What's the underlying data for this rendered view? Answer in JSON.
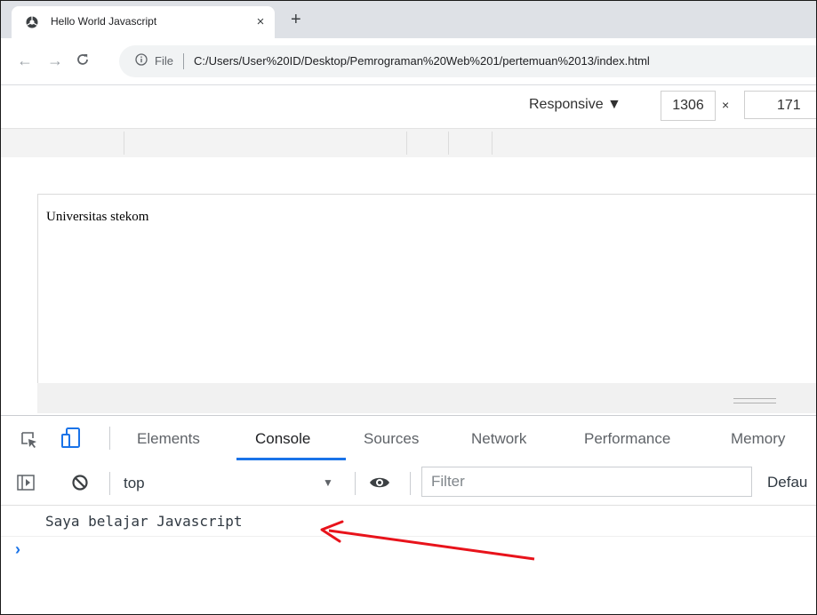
{
  "browser": {
    "tab": {
      "title": "Hello World Javascript",
      "close": "×"
    },
    "new_tab": "+",
    "nav": {
      "back": "←",
      "forward": "→",
      "reload": "C"
    },
    "address": {
      "scheme_label": "File",
      "url": "C:/Users/User%20ID/Desktop/Pemrograman%20Web%201/pertemuan%2013/index.html"
    }
  },
  "device_toolbar": {
    "mode": "Responsive ▼",
    "width": "1306",
    "times": "×",
    "height": "171"
  },
  "page": {
    "body_text": "Universitas stekom"
  },
  "devtools": {
    "tabs": [
      "Elements",
      "Console",
      "Sources",
      "Network",
      "Performance",
      "Memory"
    ],
    "active_tab": "Console",
    "console_toolbar": {
      "context": "top",
      "filter_placeholder": "Filter",
      "levels": "Defau"
    },
    "messages": [
      "Saya belajar Javascript"
    ],
    "prompt": "›"
  },
  "colors": {
    "accent": "#1a73e8",
    "annotation_arrow": "#e8131b"
  },
  "icons": [
    "chrome-favicon",
    "info-icon",
    "inspect-element-icon",
    "device-toggle-icon",
    "sidebar-toggle-icon",
    "clear-console-icon",
    "eye-icon"
  ]
}
